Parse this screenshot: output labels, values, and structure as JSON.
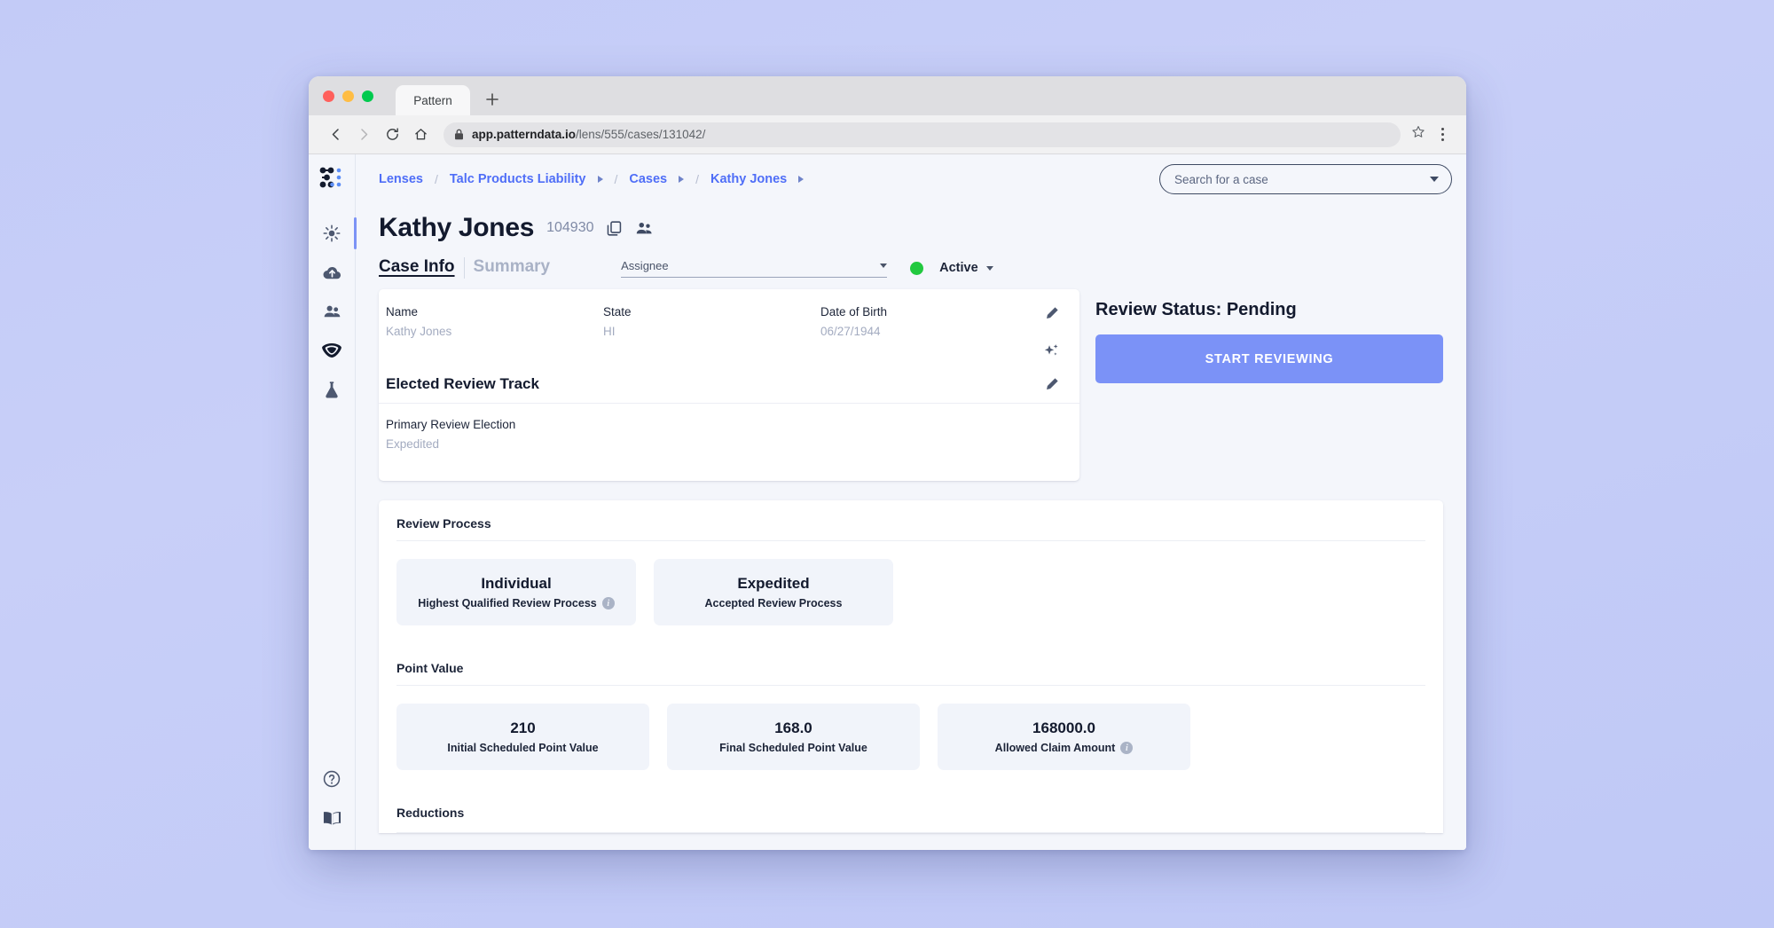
{
  "browser": {
    "tab_title": "Pattern",
    "new_tab_label": "+",
    "url_secure_prefix": "app.patterndata.io",
    "url_path": "/lens/555/cases/131042/",
    "back_icon": "back-arrow-icon",
    "forward_icon": "forward-arrow-icon",
    "reload_icon": "reload-icon",
    "home_icon": "home-icon",
    "lock_icon": "lock-icon",
    "star_icon": "bookmark-star-icon",
    "menu_icon": "kebab-menu-icon"
  },
  "sidebar": {
    "logo_name": "pattern-logo",
    "items": [
      {
        "icon": "sun-burst-icon",
        "name": "sidebar-item-insights",
        "active": true
      },
      {
        "icon": "cloud-upload-icon",
        "name": "sidebar-item-uploads",
        "active": false
      },
      {
        "icon": "people-icon",
        "name": "sidebar-item-people",
        "active": false
      },
      {
        "icon": "diamond-shield-icon",
        "name": "sidebar-item-quality",
        "active": false
      },
      {
        "icon": "flask-icon",
        "name": "sidebar-item-lab",
        "active": false
      }
    ],
    "bottom_items": [
      {
        "icon": "help-circle-icon",
        "name": "sidebar-item-help"
      },
      {
        "icon": "open-book-icon",
        "name": "sidebar-item-docs"
      }
    ]
  },
  "topbar": {
    "breadcrumb": [
      {
        "label": "Lenses",
        "caret": false
      },
      {
        "label": "Talc Products Liability",
        "caret": true
      },
      {
        "label": "Cases",
        "caret": true
      },
      {
        "label": "Kathy Jones",
        "caret": true
      }
    ],
    "separator": "/",
    "search": {
      "placeholder": "Search for a case",
      "value": ""
    }
  },
  "header": {
    "title": "Kathy Jones",
    "case_number": "104930",
    "copy_icon": "copy-icon",
    "people_icon": "people-group-icon"
  },
  "tabs": [
    {
      "label": "Case Info",
      "active": true
    },
    {
      "label": "Summary",
      "active": false
    }
  ],
  "assignee": {
    "label": "Assignee",
    "value": ""
  },
  "status": {
    "label": "Active",
    "dot_color": "#22c93f"
  },
  "case_info": {
    "fields": [
      {
        "label": "Name",
        "value": "Kathy Jones"
      },
      {
        "label": "State",
        "value": "HI"
      },
      {
        "label": "Date of Birth",
        "value": "06/27/1944"
      }
    ],
    "edit_icon": "pencil-edit-icon",
    "ai_icon": "sparkles-icon"
  },
  "elected_review_track": {
    "title": "Elected Review Track",
    "edit_icon": "pencil-edit-icon",
    "field_label": "Primary Review Election",
    "field_value": "Expedited"
  },
  "review_panel": {
    "status_title": "Review Status: Pending",
    "button_label": "START REVIEWING",
    "button_color": "#7b92f7"
  },
  "details": {
    "review_process": {
      "heading": "Review Process",
      "tiles": [
        {
          "main": "Individual",
          "sub": "Highest Qualified Review Process",
          "info": true
        },
        {
          "main": "Expedited",
          "sub": "Accepted Review Process",
          "info": false
        }
      ]
    },
    "point_value": {
      "heading": "Point Value",
      "tiles": [
        {
          "main": "210",
          "sub": "Initial Scheduled Point Value",
          "info": false
        },
        {
          "main": "168.0",
          "sub": "Final Scheduled Point Value",
          "info": false
        },
        {
          "main": "168000.0",
          "sub": "Allowed Claim Amount",
          "info": true
        }
      ]
    },
    "reductions": {
      "heading": "Reductions"
    }
  }
}
